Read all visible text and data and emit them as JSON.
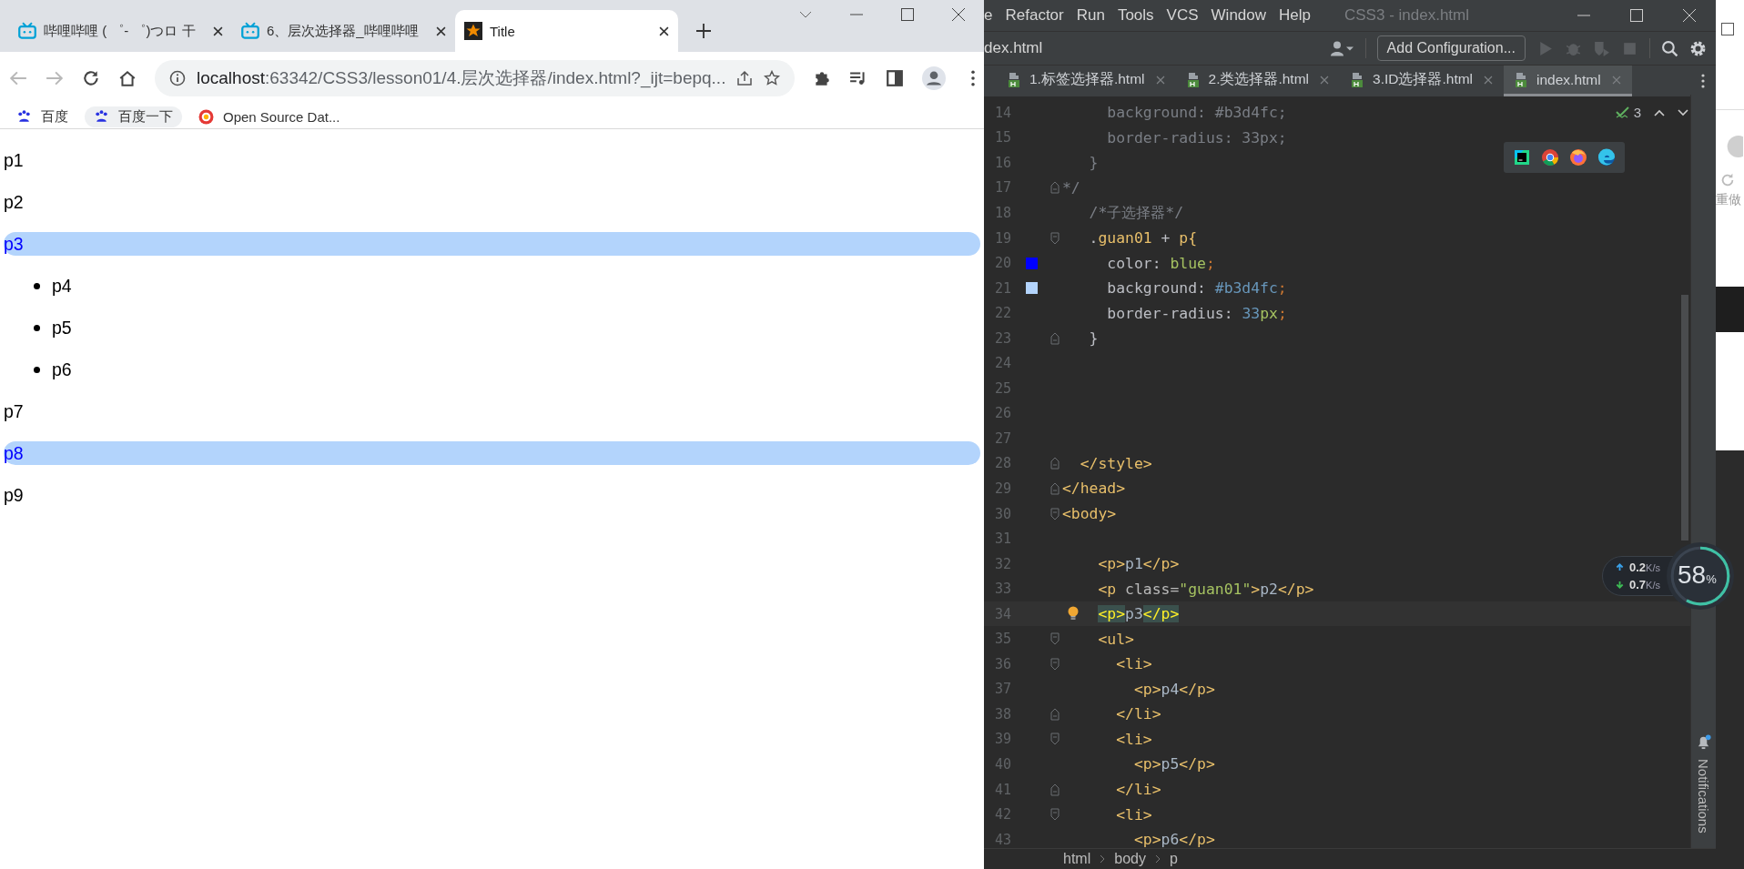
{
  "browser": {
    "tabs": [
      {
        "title": "哔哩哔哩 ( ゜- ゜)つロ 干",
        "selected": false
      },
      {
        "title": "6、层次选择器_哔哩哔哩",
        "selected": false
      },
      {
        "title": "Title",
        "selected": true
      }
    ],
    "back_enabled": false,
    "forward_enabled": false,
    "url_host": "localhost",
    "url_rest": ":63342/CSS3/lesson01/4.层次选择器/index.html?_ijt=bepq...",
    "bookmarks": [
      {
        "label": "百度",
        "hovered": false
      },
      {
        "label": "百度一下",
        "hovered": true
      },
      {
        "label": "Open Source Dat...",
        "hovered": false
      }
    ]
  },
  "page": {
    "items": [
      {
        "text": "p1",
        "kind": "p",
        "highlighted": false
      },
      {
        "text": "p2",
        "kind": "p",
        "highlighted": false
      },
      {
        "text": "p3",
        "kind": "p",
        "highlighted": true
      },
      {
        "text": "p4",
        "kind": "li",
        "highlighted": false
      },
      {
        "text": "p5",
        "kind": "li",
        "highlighted": false
      },
      {
        "text": "p6",
        "kind": "li",
        "highlighted": false
      },
      {
        "text": "p7",
        "kind": "p",
        "highlighted": false
      },
      {
        "text": "p8",
        "kind": "p",
        "highlighted": true
      },
      {
        "text": "p9",
        "kind": "p",
        "highlighted": false
      }
    ]
  },
  "ide": {
    "menu": [
      "e",
      "Refactor",
      "Run",
      "Tools",
      "VCS",
      "Window",
      "Help"
    ],
    "title": "CSS3 - index.html",
    "file_crumb": "dex.html",
    "run_config": "Add Configuration...",
    "tabs": [
      {
        "label": "1.标签选择器.html",
        "selected": false
      },
      {
        "label": "2.类选择器.html",
        "selected": false
      },
      {
        "label": "3.ID选择器.html",
        "selected": false
      },
      {
        "label": "index.html",
        "selected": true
      }
    ],
    "inspection_count": "3",
    "lines": [
      {
        "number": "14",
        "current": false,
        "fold_open": false,
        "fold_close": false,
        "tokens": [
          {
            "kind": "dim",
            "t": "     background: #b3d4fc;"
          }
        ]
      },
      {
        "number": "15",
        "current": false,
        "fold_open": false,
        "fold_close": false,
        "tokens": [
          {
            "kind": "dim",
            "t": "     border-radius: 33px;"
          }
        ]
      },
      {
        "number": "16",
        "current": false,
        "fold_open": false,
        "fold_close": false,
        "tokens": [
          {
            "kind": "dim",
            "t": "   }"
          }
        ]
      },
      {
        "number": "17",
        "current": false,
        "fold_open": false,
        "fold_close": true,
        "tokens": [
          {
            "kind": "dim",
            "t": "*/"
          }
        ]
      },
      {
        "number": "18",
        "current": false,
        "fold_open": false,
        "fold_close": false,
        "tokens": [
          {
            "kind": "dim",
            "t": "   /*子选择器*/"
          }
        ]
      },
      {
        "number": "19",
        "current": false,
        "fold_open": true,
        "fold_close": false,
        "tokens": [
          {
            "kind": "plain",
            "t": "   ."
          },
          {
            "kind": "sel",
            "t": "guan01"
          },
          {
            "kind": "plain",
            "t": " + "
          },
          {
            "kind": "tag",
            "t": "p{"
          }
        ]
      },
      {
        "number": "20",
        "current": false,
        "fold_open": false,
        "fold_close": false,
        "color": "#0000ff",
        "tokens": [
          {
            "kind": "plain",
            "t": "     color: "
          },
          {
            "kind": "val",
            "t": "blue"
          },
          {
            "kind": "punct",
            "t": ";"
          }
        ]
      },
      {
        "number": "21",
        "current": false,
        "fold_open": false,
        "fold_close": false,
        "color": "#b3d4fc",
        "tokens": [
          {
            "kind": "plain",
            "t": "     background: "
          },
          {
            "kind": "num",
            "t": "#b3d4fc"
          },
          {
            "kind": "punct",
            "t": ";"
          }
        ]
      },
      {
        "number": "22",
        "current": false,
        "fold_open": false,
        "fold_close": false,
        "tokens": [
          {
            "kind": "plain",
            "t": "     border-radius: "
          },
          {
            "kind": "num",
            "t": "33"
          },
          {
            "kind": "val",
            "t": "px"
          },
          {
            "kind": "punct",
            "t": ";"
          }
        ]
      },
      {
        "number": "23",
        "current": false,
        "fold_open": false,
        "fold_close": true,
        "tokens": [
          {
            "kind": "plain",
            "t": "   }"
          }
        ]
      },
      {
        "number": "24",
        "current": false,
        "fold_open": false,
        "fold_close": false
      },
      {
        "number": "25",
        "current": false,
        "fold_open": false,
        "fold_close": false
      },
      {
        "number": "26",
        "current": false,
        "fold_open": false,
        "fold_close": false
      },
      {
        "number": "27",
        "current": false,
        "fold_open": false,
        "fold_close": false
      },
      {
        "number": "28",
        "current": false,
        "fold_open": false,
        "fold_close": true,
        "tokens": [
          {
            "kind": "tag",
            "t": "  </style>"
          }
        ]
      },
      {
        "number": "29",
        "current": false,
        "fold_open": false,
        "fold_close": true,
        "tokens": [
          {
            "kind": "tag",
            "t": "</head>"
          }
        ]
      },
      {
        "number": "30",
        "current": false,
        "fold_open": true,
        "fold_close": false,
        "tokens": [
          {
            "kind": "tag",
            "t": "<body>"
          }
        ]
      },
      {
        "number": "31",
        "current": false,
        "fold_open": false,
        "fold_close": false
      },
      {
        "number": "32",
        "current": false,
        "fold_open": false,
        "fold_close": false,
        "tokens": [
          {
            "kind": "tag",
            "t": "    <p>"
          },
          {
            "kind": "text",
            "t": "p1"
          },
          {
            "kind": "tag",
            "t": "</p>"
          }
        ]
      },
      {
        "number": "33",
        "current": false,
        "fold_open": false,
        "fold_close": false,
        "tokens": [
          {
            "kind": "tag",
            "t": "    <p "
          },
          {
            "kind": "attr",
            "t": "class="
          },
          {
            "kind": "str",
            "t": "\"guan01\""
          },
          {
            "kind": "tag",
            "t": ">"
          },
          {
            "kind": "text",
            "t": "p2"
          },
          {
            "kind": "tag",
            "t": "</p>"
          }
        ]
      },
      {
        "number": "34",
        "current": true,
        "fold_open": false,
        "fold_close": false,
        "tokens": [
          {
            "kind": "match",
            "t": "    <p>"
          },
          {
            "kind": "text",
            "t": "p3"
          },
          {
            "kind": "match",
            "t": "</p>"
          }
        ]
      },
      {
        "number": "35",
        "current": false,
        "fold_open": true,
        "fold_close": false,
        "tokens": [
          {
            "kind": "tag",
            "t": "    <ul>"
          }
        ]
      },
      {
        "number": "36",
        "current": false,
        "fold_open": true,
        "fold_close": false,
        "tokens": [
          {
            "kind": "tag",
            "t": "      <li>"
          }
        ]
      },
      {
        "number": "37",
        "current": false,
        "fold_open": false,
        "fold_close": false,
        "tokens": [
          {
            "kind": "tag",
            "t": "        <p>"
          },
          {
            "kind": "text",
            "t": "p4"
          },
          {
            "kind": "tag",
            "t": "</p>"
          }
        ]
      },
      {
        "number": "38",
        "current": false,
        "fold_open": false,
        "fold_close": true,
        "tokens": [
          {
            "kind": "tag",
            "t": "      </li>"
          }
        ]
      },
      {
        "number": "39",
        "current": false,
        "fold_open": true,
        "fold_close": false,
        "tokens": [
          {
            "kind": "tag",
            "t": "      <li>"
          }
        ]
      },
      {
        "number": "40",
        "current": false,
        "fold_open": false,
        "fold_close": false,
        "tokens": [
          {
            "kind": "tag",
            "t": "        <p>"
          },
          {
            "kind": "text",
            "t": "p5"
          },
          {
            "kind": "tag",
            "t": "</p>"
          }
        ]
      },
      {
        "number": "41",
        "current": false,
        "fold_open": false,
        "fold_close": true,
        "tokens": [
          {
            "kind": "tag",
            "t": "      </li>"
          }
        ]
      },
      {
        "number": "42",
        "current": false,
        "fold_open": true,
        "fold_close": false,
        "tokens": [
          {
            "kind": "tag",
            "t": "      <li>"
          }
        ]
      },
      {
        "number": "43",
        "current": false,
        "fold_open": false,
        "fold_close": false,
        "tokens": [
          {
            "kind": "tag",
            "t": "        <p>"
          },
          {
            "kind": "text",
            "t": "p6"
          },
          {
            "kind": "tag",
            "t": "</p>"
          }
        ]
      }
    ],
    "breadcrumbs": [
      "html",
      "body",
      "p"
    ],
    "notifications_label": "Notifications",
    "notifications_unread": true
  },
  "network_widget": {
    "up": {
      "value": "0.2",
      "unit": "K/s"
    },
    "down": {
      "value": "0.7",
      "unit": "K/s"
    },
    "percent": "58",
    "percent_sign": "%",
    "level": 0.58
  },
  "side_strip": {
    "text": "重做"
  }
}
